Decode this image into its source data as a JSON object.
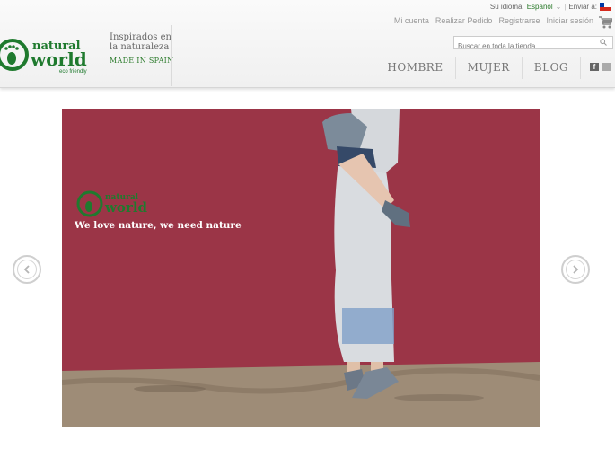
{
  "topbar": {
    "language_label": "Su idioma:",
    "language_value": "Español",
    "ship_label": "Enviar a:"
  },
  "account": {
    "links": [
      "Mi cuenta",
      "Realizar Pedido",
      "Registrarse",
      "Iniciar sesión"
    ]
  },
  "brand": {
    "line1": "natural",
    "line2": "world",
    "line3": "eco friendly",
    "tagline1": "Inspirados en",
    "tagline2": "la naturaleza",
    "made_in": "MADE IN SPAIN"
  },
  "search": {
    "placeholder": "Buscar en toda la tienda..."
  },
  "nav": {
    "items": [
      "HOMBRE",
      "MUJER",
      "BLOG"
    ]
  },
  "social": {
    "facebook_glyph": "f"
  },
  "slider": {
    "logo_line1": "natural",
    "logo_line2": "world",
    "slogan": "We love nature, we need nature"
  },
  "colors": {
    "brand_green": "#1f7a2e",
    "wall": "#a1384a",
    "ground": "#9e8c77"
  }
}
